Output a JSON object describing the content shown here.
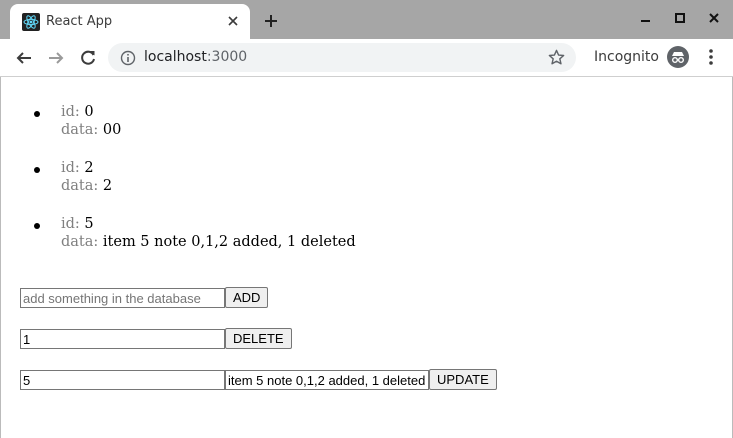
{
  "browser": {
    "tab_title": "React App",
    "url_host": "localhost",
    "url_port": ":3000",
    "incognito_label": "Incognito"
  },
  "items": [
    {
      "id_label": "id:",
      "id": "0",
      "data_label": "data:",
      "data": "00"
    },
    {
      "id_label": "id:",
      "id": "2",
      "data_label": "data:",
      "data": "2"
    },
    {
      "id_label": "id:",
      "id": "5",
      "data_label": "data:",
      "data": "item 5 note 0,1,2 added, 1 deleted"
    }
  ],
  "forms": {
    "add": {
      "placeholder": "add something in the database",
      "value": "",
      "button": "ADD"
    },
    "delete": {
      "value": "1",
      "button": "DELETE"
    },
    "update": {
      "id_value": "5",
      "data_value": "item 5 note 0,1,2 added, 1 deleted",
      "button": "UPDATE"
    }
  },
  "colors": {
    "tabstrip": "#a6a6a6",
    "label_gray": "#808080",
    "react_blue": "#61dafb"
  }
}
